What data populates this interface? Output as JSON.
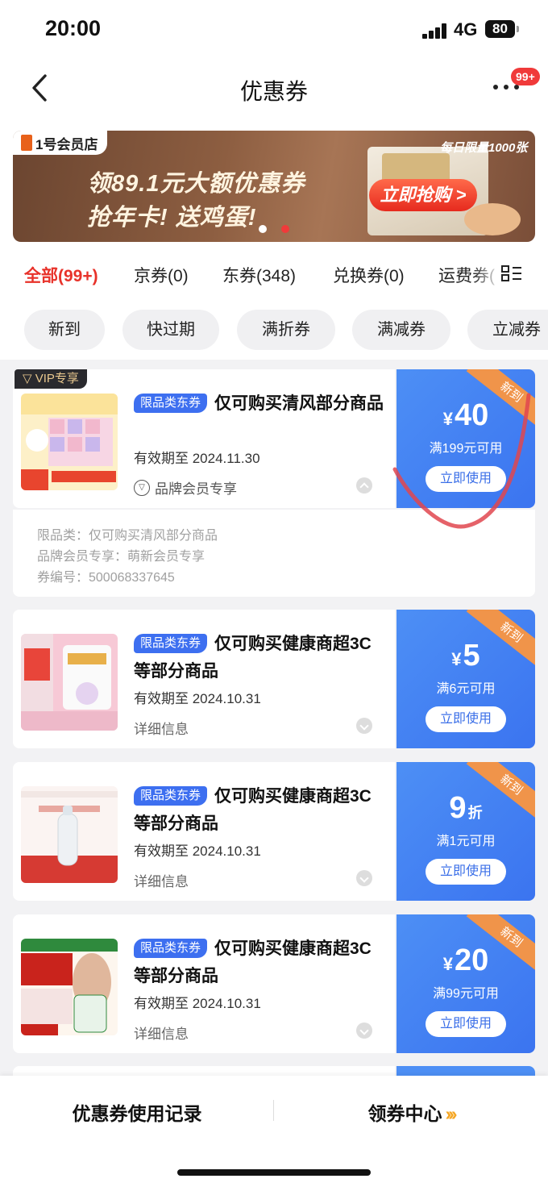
{
  "status_bar": {
    "time": "20:00",
    "network": "4G",
    "battery": "80"
  },
  "nav": {
    "title": "优惠券",
    "badge": "99+"
  },
  "banner": {
    "logo": "1号会员店",
    "line1": "领89.1元大额优惠券",
    "line2": "抢年卡! 送鸡蛋!",
    "limit": "每日限量1000张",
    "cta": "立即抢购 >"
  },
  "tabs": [
    {
      "label": "全部(99+)",
      "active": true
    },
    {
      "label": "京券(0)"
    },
    {
      "label": "东券(348)"
    },
    {
      "label": "兑换券(0)"
    },
    {
      "label": "运费券("
    }
  ],
  "filters": [
    "新到",
    "快过期",
    "满折券",
    "满减券",
    "立减券"
  ],
  "coupons": [
    {
      "vip": "VIP专享",
      "type": "限品类东券",
      "title": "仅可购买清风部分商品",
      "expiry": "有效期至 2024.11.30",
      "detail": "品牌会员专享",
      "ribbon": "新到",
      "currency": "¥",
      "amount": "40",
      "condition": "满199元可用",
      "button": "立即使用",
      "ext": [
        "限品类：仅可购买清风部分商品",
        "品牌会员专享：萌新会员专享",
        "券编号：500068337645"
      ]
    },
    {
      "type": "限品类东券",
      "title": "仅可购买健康商超3C等部分商品",
      "expiry": "有效期至 2024.10.31",
      "detail": "详细信息",
      "ribbon": "新到",
      "currency": "¥",
      "amount": "5",
      "condition": "满6元可用",
      "button": "立即使用"
    },
    {
      "type": "限品类东券",
      "title": "仅可购买健康商超3C等部分商品",
      "expiry": "有效期至 2024.10.31",
      "detail": "详细信息",
      "ribbon": "新到",
      "amount": "9",
      "unit": "折",
      "condition": "满1元可用",
      "button": "立即使用"
    },
    {
      "type": "限品类东券",
      "title": "仅可购买健康商超3C等部分商品",
      "expiry": "有效期至 2024.10.31",
      "detail": "详细信息",
      "ribbon": "新到",
      "currency": "¥",
      "amount": "20",
      "condition": "满99元可用",
      "button": "立即使用"
    }
  ],
  "bottom_bar": {
    "left": "优惠券使用记录",
    "right": "领券中心",
    "right_icon": "》"
  },
  "colors": {
    "accent_red": "#e8322a",
    "coupon_blue": "#3b74f0",
    "ribbon_orange": "#f0944a"
  }
}
